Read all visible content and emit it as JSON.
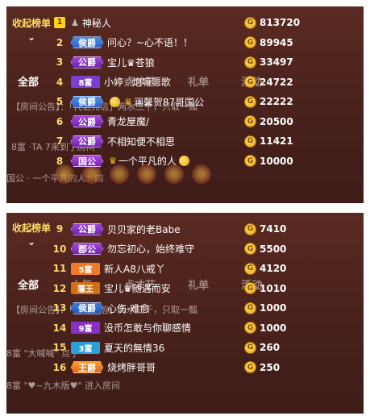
{
  "top": {
    "side_label": "收起榜单",
    "chevron": "⌄",
    "bg_tabs": [
      "全部",
      "人气",
      "点才艺",
      "礼单",
      "活动"
    ],
    "bg_notice": "【房间公告】：「代语先信」两水三千，只取一瓢",
    "bg_chat1": "8富 ·TA 7来到了房间",
    "bg_chat2": "国公 · 一个平凡的人：四",
    "rows": [
      {
        "rank": "1",
        "title": "",
        "name": "神秘人",
        "score": "813720",
        "mark": "person"
      },
      {
        "rank": "2",
        "title": "侯爵",
        "name": "问心？~心不语！！",
        "score": "89945"
      },
      {
        "rank": "3",
        "title": "公爵",
        "name": "宝儿♛苍狼",
        "score": "33497"
      },
      {
        "rank": "4",
        "title": "8富",
        "name": "小婷♡炮嘛嗯歌",
        "score": "24722"
      },
      {
        "rank": "5",
        "title": "侯爵",
        "name": "澜馨贺87哥国公",
        "score": "22222",
        "emoji": true
      },
      {
        "rank": "6",
        "title": "公爵",
        "name": "青龙屋魔/",
        "score": "20500"
      },
      {
        "rank": "7",
        "title": "公爵",
        "name": "不相知便不相思",
        "score": "11421"
      },
      {
        "rank": "8",
        "title": "国公",
        "name": "一个平凡的人",
        "score": "10000",
        "crown": true
      }
    ]
  },
  "bottom": {
    "side_label": "收起榜单",
    "chevron": "⌄",
    "bg_tabs": [
      "全部",
      "人气",
      "点才艺",
      "礼单",
      "活动"
    ],
    "bg_notice": "【房间公告】：「代语先信」两水三千，只取一瓢",
    "bg_chat1": "8富 \"大喊喊\" 点了",
    "bg_chat2": "8富 \"♥~九木版♥\" 进入房间",
    "rows": [
      {
        "rank": "9",
        "title": "公爵",
        "name": "贝贝家的老Babe",
        "score": "7410"
      },
      {
        "rank": "10",
        "title": "郡公",
        "name": "勿忘初心，始终难守",
        "score": "5500"
      },
      {
        "rank": "11",
        "title": "5富",
        "name": "新人A8八戒丫",
        "score": "4120"
      },
      {
        "rank": "12",
        "title": "藩王",
        "name": "宝儿♛随遇而安",
        "score": "1010"
      },
      {
        "rank": "13",
        "title": "侯爵",
        "name": "心伤-难愈",
        "score": "1000"
      },
      {
        "rank": "14",
        "title": "9富",
        "name": "没币怎敢与你聊感情",
        "score": "1000"
      },
      {
        "rank": "15",
        "title": "3富",
        "name": "夏天的無情36",
        "score": "260"
      },
      {
        "rank": "16",
        "title": "王爵",
        "name": "烧烤胖哥哥",
        "score": "250"
      }
    ]
  },
  "colors": {
    "background": "#4a221c",
    "accent": "#ffd966",
    "coin": "#e8a317"
  },
  "icons": [
    "coin-icon",
    "chevron-down-icon",
    "crown-icon",
    "emoji-icon",
    "person-icon"
  ]
}
